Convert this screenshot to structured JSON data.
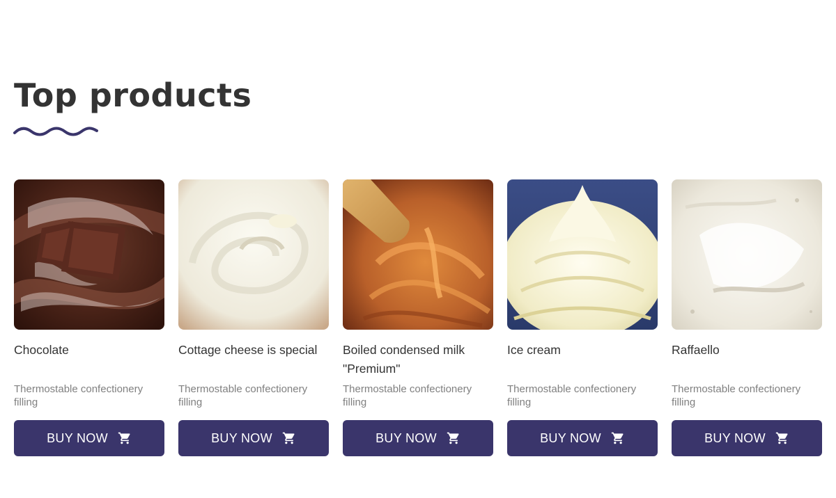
{
  "section": {
    "title": "Top products",
    "accent_color": "#3a356b"
  },
  "products": [
    {
      "name": "Chocolate",
      "description": "Thermostable confectionery filling",
      "button_label": "BUY NOW",
      "button_icon": "cart-icon",
      "image": "chocolate-photo"
    },
    {
      "name": "Cottage cheese is special",
      "description": "Thermostable confectionery filling",
      "button_label": "BUY NOW",
      "button_icon": "cart-icon",
      "image": "cottage-cheese-photo"
    },
    {
      "name": "Boiled condensed milk \"Premium\"",
      "description": "Thermostable confectionery filling",
      "button_label": "BUY NOW",
      "button_icon": "cart-icon",
      "image": "condensed-milk-photo"
    },
    {
      "name": "Ice cream",
      "description": "Thermostable confectionery filling",
      "button_label": "BUY NOW",
      "button_icon": "cart-icon",
      "image": "ice-cream-photo"
    },
    {
      "name": "Raffaello",
      "description": "Thermostable confectionery filling",
      "button_label": "BUY NOW",
      "button_icon": "cart-icon",
      "image": "raffaello-photo"
    }
  ]
}
